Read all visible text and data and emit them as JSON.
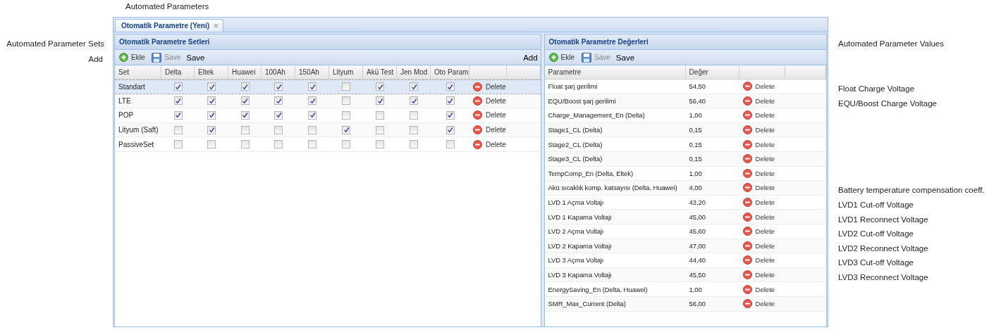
{
  "page_title": "Automated Parameters",
  "tabs": [
    {
      "label": "Otomatik Parametre (Yeni)",
      "selected": true
    }
  ],
  "sets_panel": {
    "title": "Otomatik Parametre Setleri",
    "side_note": "Automated Parameter Sets",
    "toolbar_side_note": "Add",
    "toolbar_end_note": "Add",
    "toolbar": {
      "add": "Ekle",
      "save": "Save",
      "save_note": "Save"
    },
    "columns": [
      "Set",
      "Delta",
      "Eltek",
      "Huawei",
      "100Ah",
      "150Ah",
      "Lityum",
      "Akü Test",
      "Jen Mod",
      "Oto Param"
    ],
    "rows": [
      {
        "name": "Standart",
        "selected": true,
        "checks": [
          true,
          true,
          true,
          true,
          true,
          false,
          true,
          true,
          true
        ],
        "action": "Delete"
      },
      {
        "name": "LTE",
        "selected": false,
        "checks": [
          true,
          true,
          true,
          true,
          true,
          false,
          true,
          true,
          true
        ],
        "action": "Delete"
      },
      {
        "name": "POP",
        "selected": false,
        "checks": [
          true,
          true,
          true,
          true,
          true,
          false,
          false,
          false,
          true
        ],
        "action": "Delete"
      },
      {
        "name": "Lityum (Saft)",
        "selected": false,
        "checks": [
          false,
          true,
          false,
          false,
          false,
          true,
          false,
          false,
          true
        ],
        "action": "Delete"
      },
      {
        "name": "PassiveSet",
        "selected": false,
        "checks": [
          false,
          false,
          false,
          false,
          false,
          false,
          false,
          false,
          false
        ],
        "action": "Delete"
      }
    ]
  },
  "values_panel": {
    "title": "Otomatik Parametre Değerleri",
    "side_note": "Automated Parameter Values",
    "toolbar": {
      "add": "Ekle",
      "save": "Save",
      "save_note": "Save"
    },
    "columns": [
      "Parametre",
      "Değer"
    ],
    "rows": [
      {
        "name": "Float şarj gerilimi",
        "value": "54,50",
        "action": "Delete",
        "note": "Float Charge Voltage"
      },
      {
        "name": "EQU/Boost şarj gerilimi",
        "value": "56,40",
        "action": "Delete",
        "note": "EQU/Boost Charge Voltage"
      },
      {
        "name": "Charge_Management_En (Delta)",
        "value": "1,00",
        "action": "Delete"
      },
      {
        "name": "Stage1_CL (Delta)",
        "value": "0,15",
        "action": "Delete"
      },
      {
        "name": "Stage2_CL (Delta)",
        "value": "0,15",
        "action": "Delete"
      },
      {
        "name": "Stage3_CL (Delta)",
        "value": "0,15",
        "action": "Delete"
      },
      {
        "name": "TempComp_En (Delta, Eltek)",
        "value": "1,00",
        "action": "Delete"
      },
      {
        "name": "Akü sıcaklık komp. katsayısı (Delta, Huawei)",
        "value": "4,00",
        "action": "Delete",
        "note": "Battery temperature compensation coeff."
      },
      {
        "name": "LVD 1 Açma Voltajı",
        "value": "43,20",
        "action": "Delete",
        "note": "LVD1 Cut-off Voltage"
      },
      {
        "name": "LVD 1 Kapama Voltajı",
        "value": "45,00",
        "action": "Delete",
        "note": "LVD1 Reconnect Voltage"
      },
      {
        "name": "LVD 2 Açma Voltajı",
        "value": "45,60",
        "action": "Delete",
        "note": "LVD2 Cut-off Voltage"
      },
      {
        "name": "LVD 2 Kapama Voltajı",
        "value": "47,00",
        "action": "Delete",
        "note": "LVD2 Reconnect Voltage"
      },
      {
        "name": "LVD 3 Açma Voltajı",
        "value": "44,40",
        "action": "Delete",
        "note": "LVD3 Cut-off Voltage"
      },
      {
        "name": "LVD 3 Kapama Voltajı",
        "value": "45,50",
        "action": "Delete",
        "note": "LVD3 Reconnect Voltage"
      },
      {
        "name": "EnergySaving_En (Delta, Huawei)",
        "value": "1,00",
        "action": "Delete"
      },
      {
        "name": "SMR_Max_Current (Delta)",
        "value": "56,00",
        "action": "Delete"
      }
    ]
  }
}
